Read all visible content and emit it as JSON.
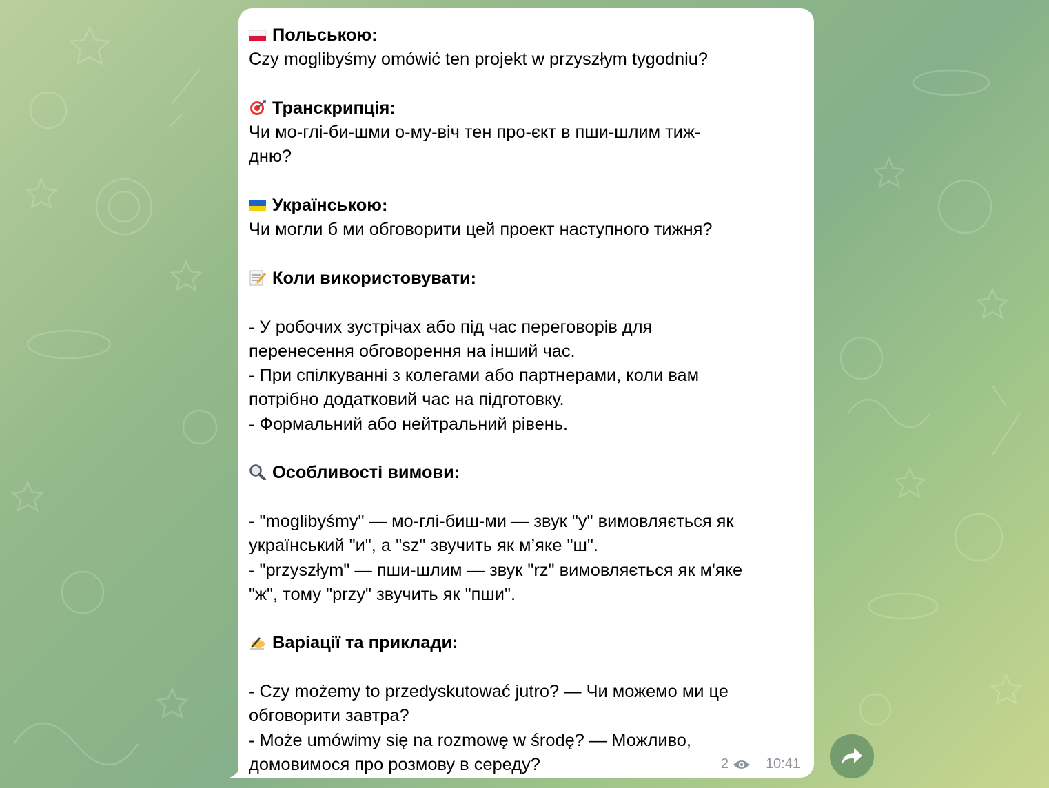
{
  "message": {
    "polish": {
      "heading": "Польською:",
      "text": "Czy moglibyśmy omówić ten projekt w przyszłym tygodniu?"
    },
    "transcription": {
      "heading": "Транскрипція:",
      "lines": [
        "Чи мо-глі-би-шми о-му-віч тен про-єкт в пши-шлим тиж-",
        "дню?"
      ]
    },
    "ukrainian": {
      "heading": "Українською:",
      "text": "Чи могли б ми обговорити цей проект наступного тижня?"
    },
    "when": {
      "heading": "Коли використовувати:",
      "lines": [
        "- У робочих зустрічах або під час переговорів для",
        "перенесення обговорення на інший час.",
        "- При спілкуванні з колегами або партнерами, коли вам",
        "потрібно додатковий час на підготовку.",
        "- Формальний або нейтральний рівень."
      ]
    },
    "pronunciation": {
      "heading": "Особливості вимови:",
      "lines": [
        "- \"moglibyśmy\" — мо-глі-биш-ми — звук \"y\" вимовляється як",
        "український \"и\", а \"sz\" звучить як м’яке \"ш\".",
        "- \"przyszłym\" — пши-шлим — звук \"rz\" вимовляється як м'яке",
        "\"ж\", тому \"przy\" звучить як \"пши\"."
      ]
    },
    "variations": {
      "heading": "Варіації та приклади:",
      "lines": [
        "- Czy możemy to przedyskutować jutro? — Чи можемо ми це",
        "обговорити завтра?",
        "- Może umówimy się na rozmowę w środę? — Можливо,",
        "домовимося про розмову в середу?"
      ]
    },
    "views": "2",
    "time": "10:41"
  },
  "icons": {
    "polish": "poland-flag-icon",
    "transcription": "target-icon",
    "ukrainian": "ukraine-flag-icon",
    "when": "memo-icon",
    "pronunciation": "magnifier-icon",
    "variations": "writing-hand-icon",
    "views": "eye-icon",
    "share": "share-arrow-icon"
  },
  "colors": {
    "bubble": "#ffffff",
    "meta_text": "#8d959b",
    "share_button": "#608c64"
  }
}
